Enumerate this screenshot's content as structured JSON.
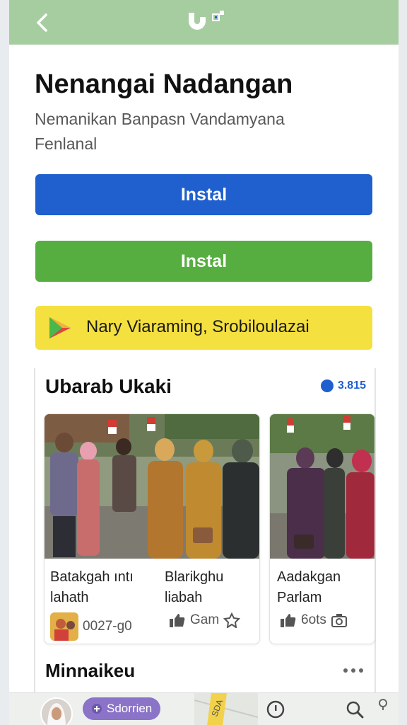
{
  "header": {
    "back_icon": "chevron-left-icon",
    "logo_icon": "app-logo-icon"
  },
  "page": {
    "title": "Nenangai Nadangan",
    "subtitle_line1": "Nemanikan Banpasn Vandamyana",
    "subtitle_line2": "Fenlanal"
  },
  "buttons": {
    "install_primary": "Instal",
    "install_secondary": "Instal"
  },
  "banner": {
    "icon": "play-store-icon",
    "text": "Nary Viaraming, Srobiloulazai"
  },
  "section": {
    "title": "Ubarab Ukaki",
    "count": "3.815",
    "cards": [
      {
        "caption_left_line1": "Batakgah ıntı",
        "caption_left_line2": "lahath",
        "caption_right_line1": "Blarikghu",
        "caption_right_line2": "liabah",
        "meta_date": "0027-g0",
        "meta_like": "Gam"
      },
      {
        "caption_line1": "Aadakgan",
        "caption_line2": "Parlam",
        "meta_count": "6ots"
      }
    ]
  },
  "section2": {
    "title": "Minnaikeu"
  },
  "bottom_nav": {
    "chip_label": "Sdorrien",
    "map_label": "SDA"
  },
  "colors": {
    "topbar": "#a6cda0",
    "install_blue": "#1f5fce",
    "install_green": "#57ae40",
    "banner_yellow": "#f4e03f",
    "chip_purple": "#8b73c8"
  }
}
